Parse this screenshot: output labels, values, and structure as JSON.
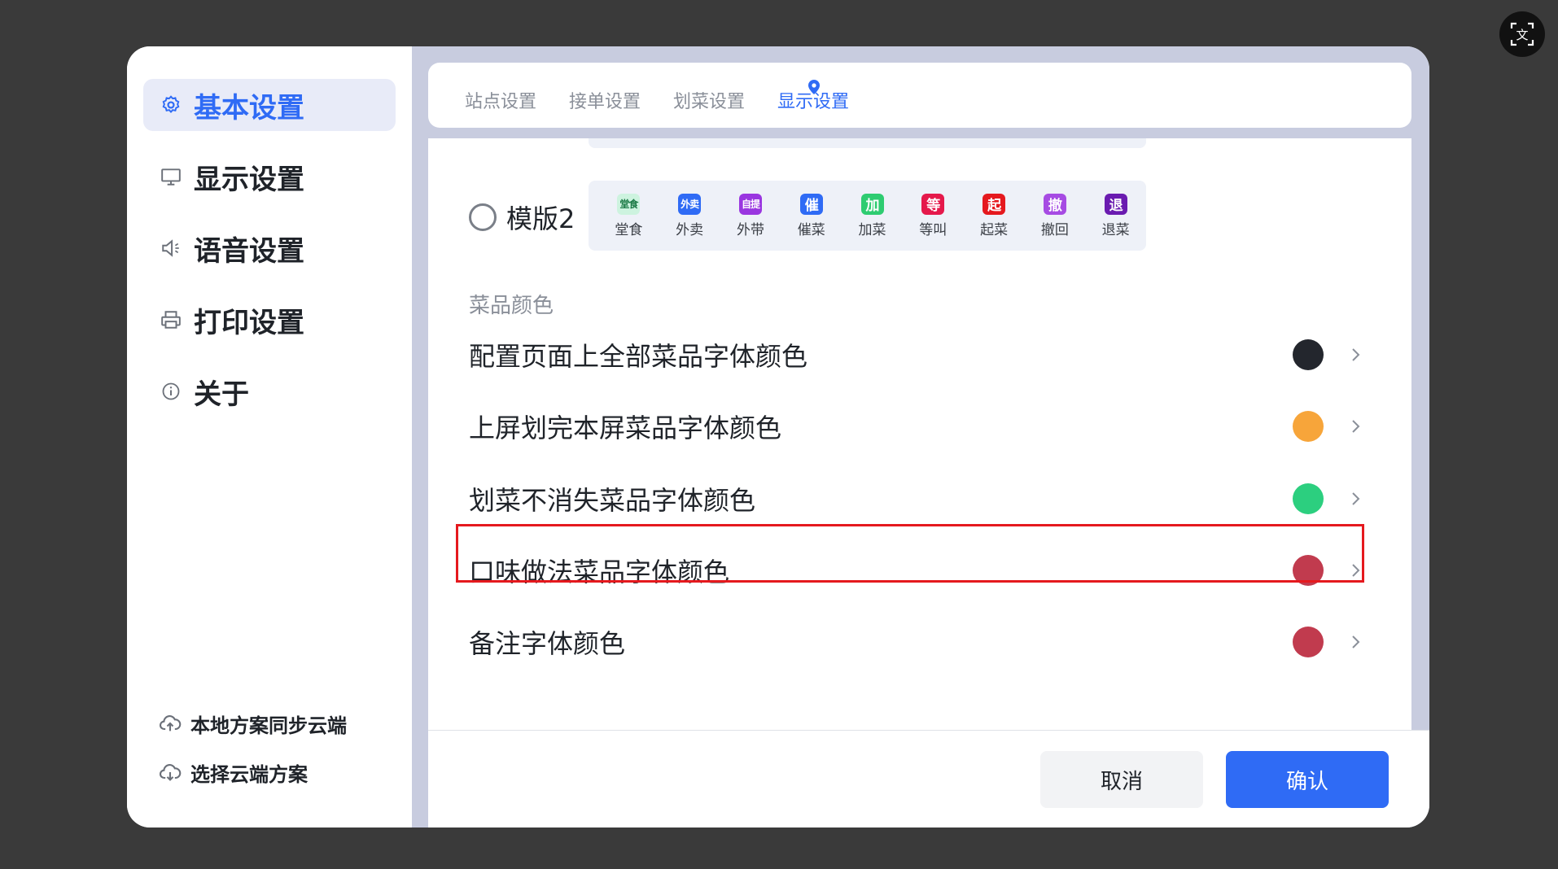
{
  "sidebar": {
    "items": [
      {
        "label": "基本设置",
        "icon": "gear-icon",
        "active": true
      },
      {
        "label": "显示设置",
        "icon": "monitor-icon",
        "active": false
      },
      {
        "label": "语音设置",
        "icon": "speaker-icon",
        "active": false
      },
      {
        "label": "打印设置",
        "icon": "printer-icon",
        "active": false
      },
      {
        "label": "关于",
        "icon": "info-icon",
        "active": false
      }
    ],
    "bottom": [
      {
        "label": "本地方案同步云端",
        "icon": "cloud-upload-icon"
      },
      {
        "label": "选择云端方案",
        "icon": "cloud-download-icon"
      }
    ]
  },
  "tabs": [
    {
      "label": "站点设置",
      "active": false
    },
    {
      "label": "接单设置",
      "active": false
    },
    {
      "label": "划菜设置",
      "active": false
    },
    {
      "label": "显示设置",
      "active": true
    }
  ],
  "template": {
    "label": "模版2",
    "badges": [
      {
        "tag": "堂食",
        "text": "堂食",
        "color": "#3ccf8e"
      },
      {
        "tag": "外卖",
        "text": "外卖",
        "color": "#2f6bf5"
      },
      {
        "tag": "自提",
        "text": "外带",
        "color": "#9a36e0"
      },
      {
        "tag": "催",
        "text": "催菜",
        "color": "#2f6bf5"
      },
      {
        "tag": "加",
        "text": "加菜",
        "color": "#2ecc71"
      },
      {
        "tag": "等",
        "text": "等叫",
        "color": "#e5194b"
      },
      {
        "tag": "起",
        "text": "起菜",
        "color": "#e5191e"
      },
      {
        "tag": "撤",
        "text": "撤回",
        "color": "#a64be3"
      },
      {
        "tag": "退",
        "text": "退菜",
        "color": "#6a1bb0"
      }
    ]
  },
  "section_title": "菜品颜色",
  "color_settings": [
    {
      "label": "配置页面上全部菜品字体颜色",
      "color": "#23262d"
    },
    {
      "label": "上屏划完本屏菜品字体颜色",
      "color": "#f7a53a"
    },
    {
      "label": "划菜不消失菜品字体颜色",
      "color": "#2ccf7f"
    },
    {
      "label": "口味做法菜品字体颜色",
      "color": "#c13b4e"
    },
    {
      "label": "备注字体颜色",
      "color": "#c13b4e"
    }
  ],
  "buttons": {
    "cancel": "取消",
    "confirm": "确认"
  },
  "translate_icon": "translate-icon"
}
